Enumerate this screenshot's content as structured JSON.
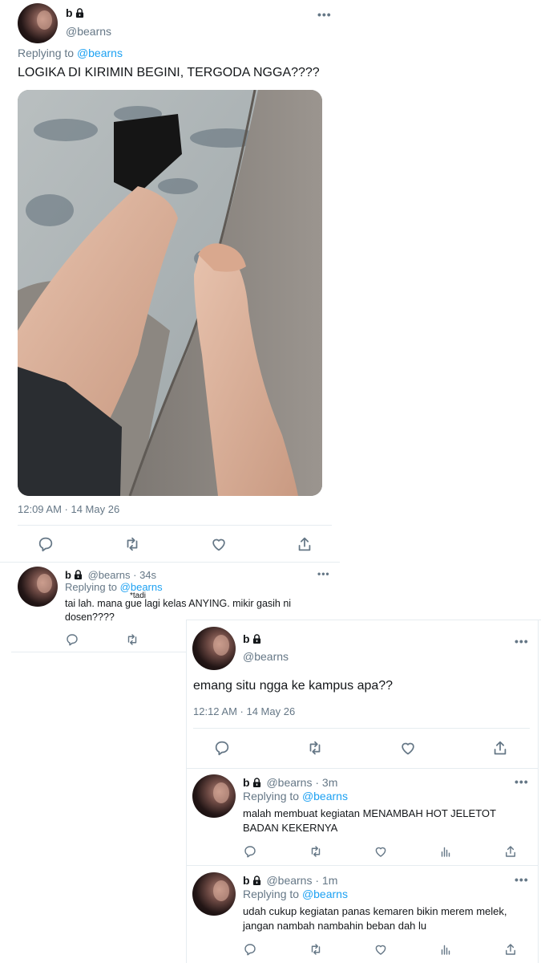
{
  "tweet1": {
    "name": "b",
    "handle": "@bearns",
    "replying_prefix": "Replying to ",
    "replying_to": "@bearns",
    "text": "LOGIKA DI KIRIMIN BEGINI, TERGODA NGGA????",
    "timestamp": "12:09 AM · 14 May 26"
  },
  "reply1": {
    "name": "b",
    "handle_time": "@bearns · 34s",
    "replying_prefix": "Replying to ",
    "replying_to": "@bearns",
    "annotation": "*tadi",
    "text": "tai lah. mana gue lagi kelas ANYING. mikir gasih ni dosen????"
  },
  "tweet2": {
    "name": "b",
    "handle": "@bearns",
    "text": "emang situ ngga ke kampus apa??",
    "timestamp": "12:12 AM · 14 May 26"
  },
  "reply2": {
    "name": "b",
    "handle_time": "@bearns · 3m",
    "replying_prefix": "Replying to ",
    "replying_to": "@bearns",
    "text": "malah membuat kegiatan MENAMBAH HOT JELETOT BADAN KEKERNYA"
  },
  "reply3": {
    "name": "b",
    "handle_time": "@bearns · 1m",
    "replying_prefix": "Replying to ",
    "replying_to": "@bearns",
    "text": "udah cukup kegiatan panas kemaren bikin merem melek, jangan nambah nambahin beban dah lu"
  },
  "icons": [
    "reply-icon",
    "retweet-icon",
    "like-icon",
    "share-icon",
    "analytics-icon",
    "lock-icon",
    "more-icon"
  ],
  "colors": {
    "link": "#1da1f2",
    "muted": "#657786",
    "text": "#14171a",
    "divider": "#e6ecf0"
  }
}
